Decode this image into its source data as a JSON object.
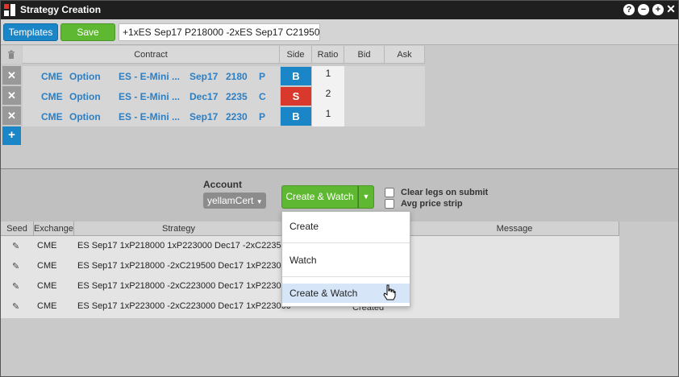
{
  "window": {
    "title": "Strategy Creation"
  },
  "toolbar": {
    "templates_label": "Templates",
    "save_label": "Save",
    "strategy_text": "+1xES Sep17 P218000 -2xES Sep17 C21950"
  },
  "legs_table": {
    "headers": {
      "contract": "Contract",
      "side": "Side",
      "ratio": "Ratio",
      "bid": "Bid",
      "ask": "Ask"
    },
    "rows": [
      {
        "exchange": "CME",
        "type": "Option",
        "product": "ES - E-Mini ...",
        "expiry": "Sep17",
        "strike": "2180",
        "cp": "P",
        "side": "B",
        "ratio": "1"
      },
      {
        "exchange": "CME",
        "type": "Option",
        "product": "ES - E-Mini ...",
        "expiry": "Dec17",
        "strike": "2235",
        "cp": "C",
        "side": "S",
        "ratio": "2"
      },
      {
        "exchange": "CME",
        "type": "Option",
        "product": "ES - E-Mini ...",
        "expiry": "Sep17",
        "strike": "2230",
        "cp": "P",
        "side": "B",
        "ratio": "1"
      }
    ],
    "delete_glyph": "✕",
    "add_glyph": "+"
  },
  "submit": {
    "account_label": "Account",
    "account_value": "yellamCert",
    "action_label": "Create & Watch",
    "clear_legs_label": "Clear legs on submit",
    "avg_price_label": "Avg price strip"
  },
  "dropdown": {
    "items": [
      "Create",
      "Watch",
      "Create & Watch"
    ],
    "highlighted": "Create & Watch"
  },
  "results_table": {
    "headers": {
      "seed": "Seed",
      "exchange": "Exchange",
      "strategy": "Strategy",
      "message": "Message"
    },
    "rows": [
      {
        "exchange": "CME",
        "strategy": "ES Sep17 1xP218000 1xP223000 Dec17 -2xC223500"
      },
      {
        "exchange": "CME",
        "strategy": "ES Sep17 1xP218000 -2xC219500 Dec17 1xP223000"
      },
      {
        "exchange": "CME",
        "strategy": "ES Sep17 1xP218000 -2xC223000 Dec17 1xP223000"
      },
      {
        "exchange": "CME",
        "strategy": "ES Sep17 1xP223000 -2xC223000 Dec17 1xP223000",
        "status": "Created"
      }
    ]
  },
  "colors": {
    "accent_blue": "#1a86c8",
    "green": "#5fb832",
    "sell_red": "#d9392c",
    "contract_text": "#2d7fc4"
  },
  "icons": [
    "app-logo",
    "help-icon",
    "minimize-icon",
    "maximize-icon",
    "close-icon",
    "trash-icon",
    "delete-leg-icon",
    "add-leg-icon",
    "dropdown-caret-icon",
    "pencil-icon",
    "hand-cursor-icon"
  ]
}
